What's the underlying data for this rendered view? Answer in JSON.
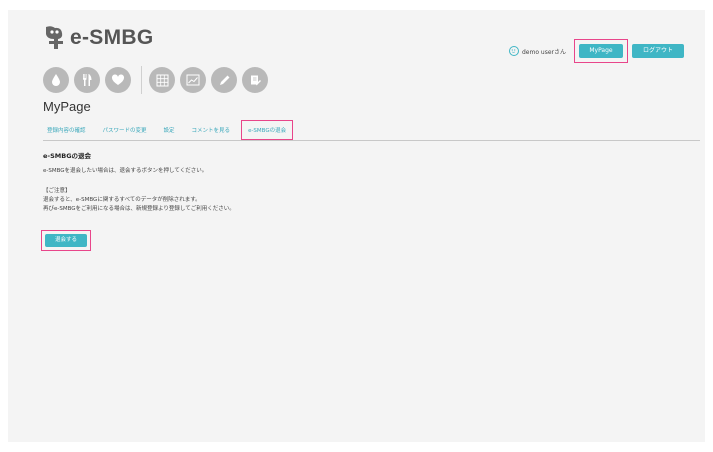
{
  "brand": {
    "name": "e-SMBG"
  },
  "header": {
    "user_label": "demo userさん",
    "mypage_label": "MyPage",
    "logout_label": "ログアウト"
  },
  "nav_icons": [
    {
      "name": "drop-icon"
    },
    {
      "name": "meal-icon"
    },
    {
      "name": "heart-icon"
    },
    {
      "name": "calendar-grid-icon"
    },
    {
      "name": "line-chart-icon"
    },
    {
      "name": "pencil-icon"
    },
    {
      "name": "note-edit-icon"
    }
  ],
  "page": {
    "title": "MyPage"
  },
  "tabs": [
    {
      "label": "登録内容の確認"
    },
    {
      "label": "パスワードの変更"
    },
    {
      "label": "設定"
    },
    {
      "label": "コメントを見る"
    },
    {
      "label": "e-SMBGの退会"
    }
  ],
  "content": {
    "heading": "e-SMBGの退会",
    "intro": "e-SMBGを退会したい場合は、退会するボタンを押してください。",
    "notice_title": "【ご注意】",
    "notice_line1": "退会すると、e-SMBGに関するすべてのデータが削除されます。",
    "notice_line2": "再びe-SMBGをご利用になる場合は、新規登録より登録してご利用ください。",
    "withdraw_button": "退会する"
  },
  "colors": {
    "accent": "#3fb6c5",
    "highlight": "#e8458a",
    "icon_gray": "#b9b9b9"
  }
}
